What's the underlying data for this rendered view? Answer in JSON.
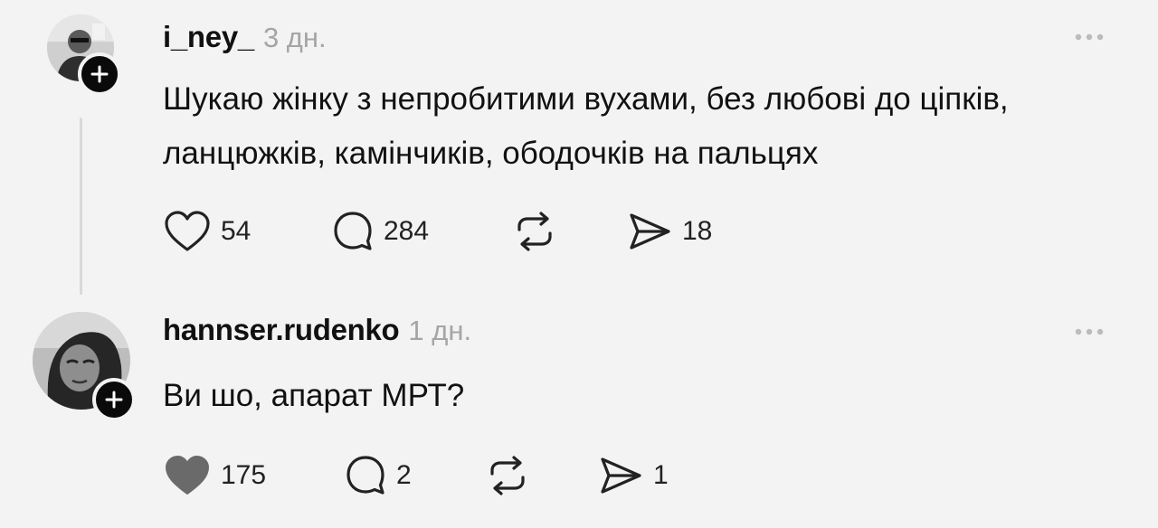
{
  "posts": [
    {
      "username": "i_ney_",
      "time": "3 дн.",
      "avatar_icon": "user-avatar-photo",
      "text": "Шукаю жінку з непробитими вухами, без любові до ціпків, ланцюжків, камінчиків, ободочків на пальцях",
      "likes": "54",
      "liked": false,
      "comments": "284",
      "reposts": "",
      "shares": "18"
    },
    {
      "username": "hannser.rudenko",
      "time": "1 дн.",
      "avatar_icon": "user-avatar-photo",
      "text": "Ви шо, апарат МРТ?",
      "likes": "175",
      "liked": true,
      "comments": "2",
      "reposts": "",
      "shares": "1"
    }
  ],
  "colors": {
    "background": "#f3f3f3",
    "text": "#111111",
    "muted": "#a5a5a5",
    "thread_line": "#d9d9d9",
    "liked_heart": "#6a6a6a"
  },
  "icons": {
    "like": "heart-icon",
    "comment": "comment-bubble-icon",
    "repost": "repost-arrows-icon",
    "share": "send-paper-plane-icon",
    "more": "more-dots-icon",
    "follow": "plus-icon"
  }
}
